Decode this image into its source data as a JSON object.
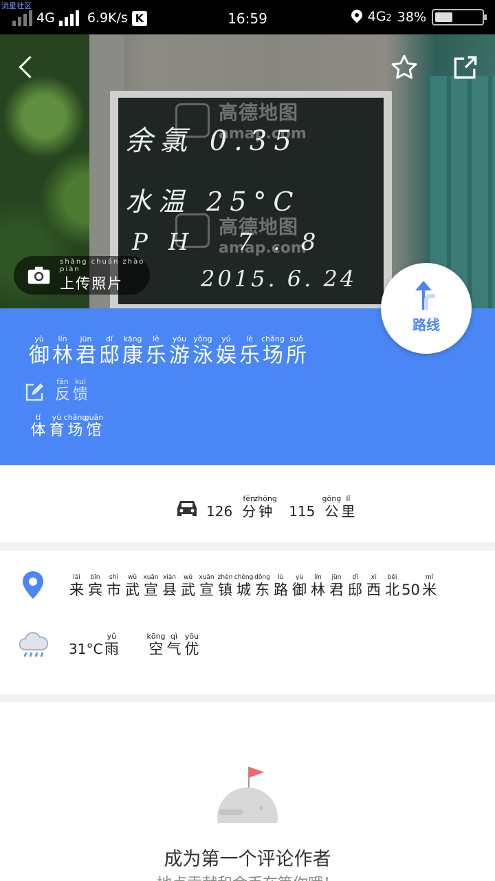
{
  "status_bar": {
    "watermark": "流星社区",
    "network": "4G",
    "speed": "6.9K/s",
    "k_icon": "K",
    "time": "16:59",
    "network_right": "4G",
    "network_right_sub": "2",
    "battery": "38%",
    "battery_level": 0.38
  },
  "photo": {
    "board_lines": [
      "余氯 0.35",
      "水温 25°C",
      "PH 7.8",
      "2015. 6. 24"
    ],
    "watermark_cn": "高德地图",
    "watermark_en": "amap.com",
    "upload_pinyin": "shàng chuán zhào  piàn",
    "upload_label": "上传照片"
  },
  "route": {
    "label": "路线"
  },
  "place": {
    "name": [
      {
        "ch": "御",
        "py": "yù"
      },
      {
        "ch": "林",
        "py": "lín"
      },
      {
        "ch": "君",
        "py": "jūn"
      },
      {
        "ch": "邸",
        "py": "dǐ"
      },
      {
        "ch": "康",
        "py": "kāng"
      },
      {
        "ch": "乐",
        "py": "lè"
      },
      {
        "ch": "游",
        "py": "yóu"
      },
      {
        "ch": "泳",
        "py": "yǒng"
      },
      {
        "ch": "娱",
        "py": "yú"
      },
      {
        "ch": "乐",
        "py": "lè"
      },
      {
        "ch": "场",
        "py": "chǎng"
      },
      {
        "ch": "所",
        "py": "suǒ"
      }
    ],
    "feedback": [
      {
        "ch": "反",
        "py": "fǎn"
      },
      {
        "ch": "馈",
        "py": "kuì"
      }
    ],
    "category": [
      {
        "ch": "体",
        "py": "tǐ"
      },
      {
        "ch": "育",
        "py": "yù"
      },
      {
        "ch": "场",
        "py": "chǎng"
      },
      {
        "ch": "馆",
        "py": "guǎn"
      }
    ]
  },
  "drive": {
    "minutes": "126",
    "minute_unit": [
      {
        "ch": "分",
        "py": "fēn"
      },
      {
        "ch": "钟",
        "py": "zhōng"
      }
    ],
    "distance": "115",
    "distance_unit": [
      {
        "ch": "公",
        "py": "gōng"
      },
      {
        "ch": "里",
        "py": "lǐ"
      }
    ]
  },
  "address": {
    "text": [
      {
        "ch": "来",
        "py": "lái"
      },
      {
        "ch": "宾",
        "py": "bīn"
      },
      {
        "ch": "市",
        "py": "shì"
      },
      {
        "ch": "武",
        "py": "wǔ"
      },
      {
        "ch": "宣",
        "py": "xuān"
      },
      {
        "ch": "县",
        "py": "xiàn"
      },
      {
        "ch": "武",
        "py": "wǔ"
      },
      {
        "ch": "宣",
        "py": "xuān"
      },
      {
        "ch": "镇",
        "py": "zhèn"
      },
      {
        "ch": "城",
        "py": "chéng"
      },
      {
        "ch": "东",
        "py": "dōng"
      },
      {
        "ch": "路",
        "py": "lù"
      },
      {
        "ch": "御",
        "py": "yù"
      },
      {
        "ch": "林",
        "py": "lín"
      },
      {
        "ch": "君",
        "py": "jūn"
      },
      {
        "ch": "邸",
        "py": "dǐ"
      },
      {
        "ch": "西",
        "py": "xī"
      },
      {
        "ch": "北",
        "py": "běi"
      },
      {
        "ch": "50",
        "py": ""
      },
      {
        "ch": "米",
        "py": "mǐ"
      }
    ]
  },
  "weather": {
    "temp": "31°C",
    "condition": [
      {
        "ch": "雨",
        "py": "yǔ"
      }
    ],
    "air": [
      {
        "ch": "空",
        "py": "kōng"
      },
      {
        "ch": "气",
        "py": "qì"
      },
      {
        "ch": "优",
        "py": "yōu"
      }
    ]
  },
  "comments": {
    "title": "成为第一个评论作者",
    "subtitle": "地点贡献和金币在等你哦！"
  },
  "colors": {
    "accent": "#4a86f5",
    "flag": "#f06a6a"
  }
}
